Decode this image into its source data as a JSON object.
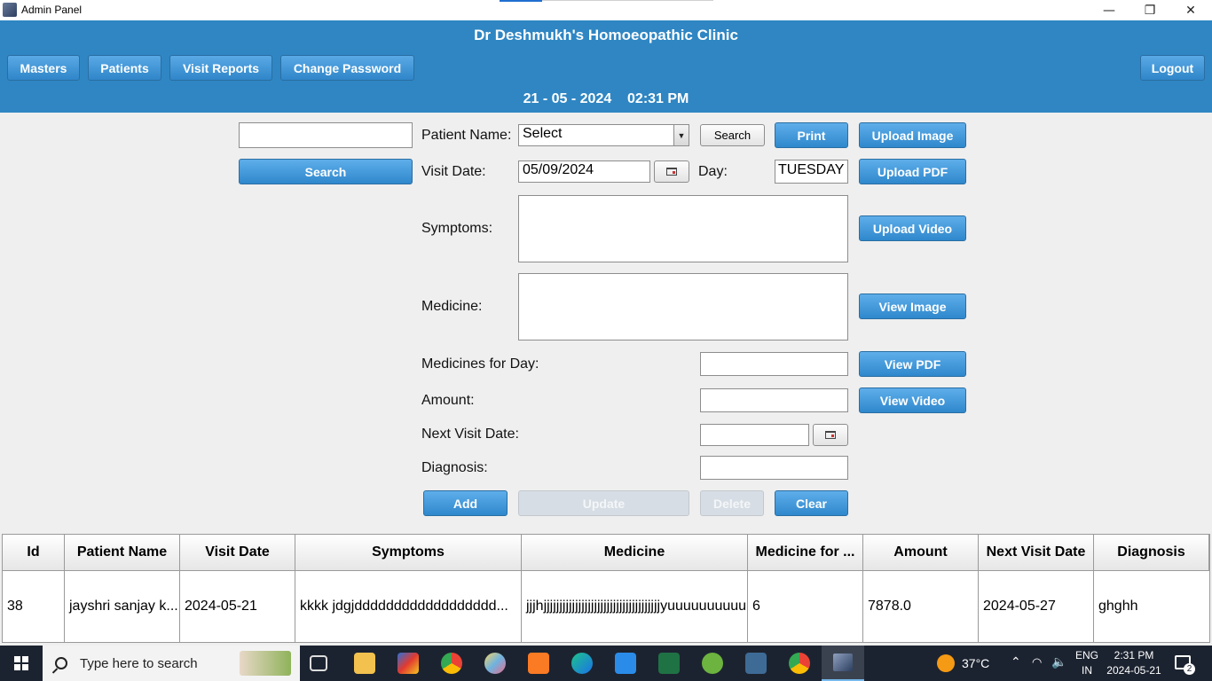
{
  "window": {
    "title": "Admin Panel",
    "minimize": "—",
    "restore": "❐",
    "close": "✕"
  },
  "header": {
    "clinic_name": "Dr Deshmukh's Homoeopathic Clinic",
    "nav": [
      "Masters",
      "Patients",
      "Visit Reports",
      "Change Password"
    ],
    "logout": "Logout",
    "datetime": "21 - 05 - 2024    02:31 PM"
  },
  "form": {
    "search_value": "",
    "search_button": "Search",
    "patient_name_label": "Patient Name:",
    "patient_select_value": "Select",
    "patient_search_button": "Search",
    "print_button": "Print",
    "upload_image_button": "Upload Image",
    "visit_date_label": "Visit Date:",
    "visit_date_value": "05/09/2024",
    "day_label": "Day:",
    "day_value": "TUESDAY",
    "upload_pdf_button": "Upload PDF",
    "symptoms_label": "Symptoms:",
    "symptoms_value": "",
    "upload_video_button": "Upload Video",
    "medicine_label": "Medicine:",
    "medicine_value": "",
    "view_image_button": "View Image",
    "medicines_for_day_label": "Medicines for Day:",
    "medicines_for_day_value": "",
    "view_pdf_button": "View PDF",
    "amount_label": "Amount:",
    "amount_value": "",
    "view_video_button": "View Video",
    "next_visit_date_label": "Next Visit Date:",
    "next_visit_date_value": "",
    "diagnosis_label": "Diagnosis:",
    "diagnosis_value": "",
    "add_button": "Add",
    "update_button": "Update",
    "delete_button": "Delete",
    "clear_button": "Clear"
  },
  "table": {
    "columns": [
      "Id",
      "Patient Name",
      "Visit Date",
      "Symptoms",
      "Medicine",
      "Medicine for ...",
      "Amount",
      "Next Visit Date",
      "Diagnosis"
    ],
    "rows": [
      [
        "38",
        "jayshri sanjay k...",
        "2024-05-21",
        "kkkk jdgjdddddddddddddddddd...",
        "jjjhjjjjjjjjjjjjjjjjjjjjjjjjjjjjjjjjjjjjjyuuuuuuuuuu...",
        "6",
        "7878.0",
        "2024-05-27",
        "ghghh"
      ]
    ]
  },
  "taskbar": {
    "search_placeholder": "Type here to search",
    "weather": "37°C",
    "language": "ENG",
    "region": "IN",
    "time": "2:31 PM",
    "date": "2024-05-21",
    "notifications": "2"
  }
}
